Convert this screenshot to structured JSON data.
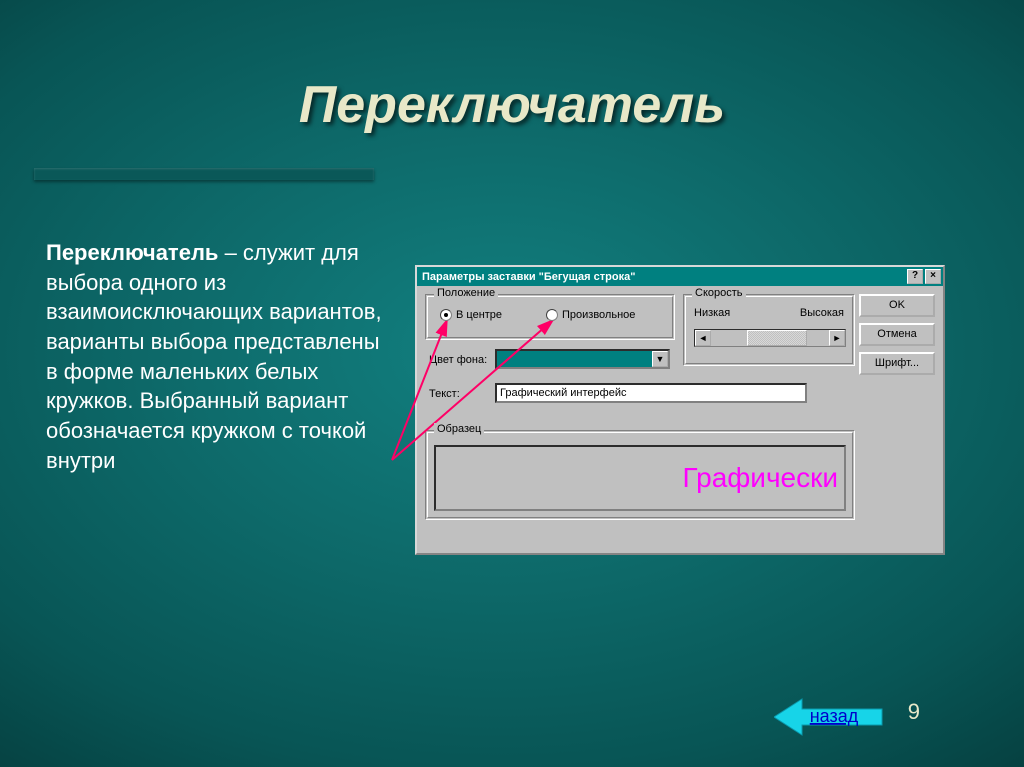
{
  "slide": {
    "title": "Переключатель",
    "body_bold": "Переключатель",
    "body_rest": " – служит для выбора одного из взаимоисключающих вариантов, варианты выбора представлены в форме маленьких белых кружков. Выбранный вариант обозначается кружком с точкой внутри",
    "page_number": "9",
    "back_label": "назад"
  },
  "dialog": {
    "title": "Параметры заставки \"Бегущая строка\"",
    "help_btn": "?",
    "close_btn": "×",
    "group_position": "Положение",
    "radio_center": "В центре",
    "radio_free": "Произвольное",
    "group_speed": "Скорость",
    "speed_low": "Низкая",
    "speed_high": "Высокая",
    "bg_color_label": "Цвет фона:",
    "text_label": "Текст:",
    "text_value": "Графический интерфейс",
    "group_sample": "Образец",
    "sample_text": "Графически",
    "buttons": {
      "ok": "OK",
      "cancel": "Отмена",
      "font": "Шрифт..."
    }
  }
}
